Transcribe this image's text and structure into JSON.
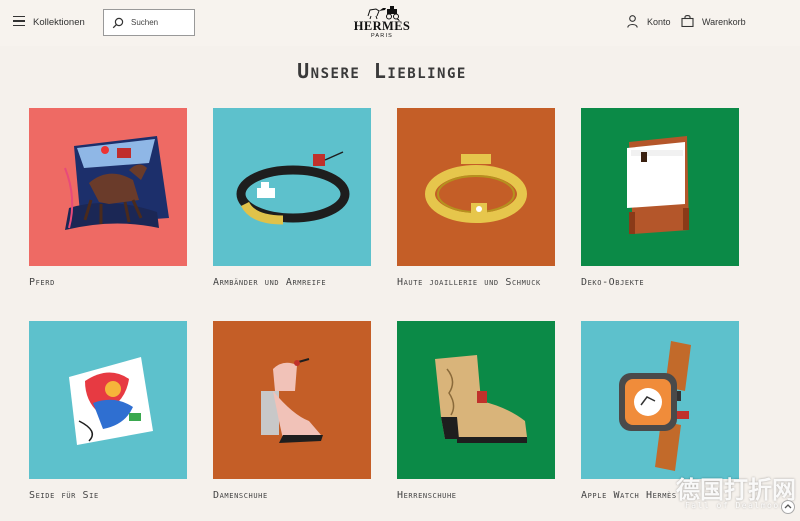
{
  "header": {
    "menu_label": "Kollektionen",
    "search_placeholder": "Suchen",
    "logo_name": "HERMÈS",
    "logo_city": "PARIS",
    "account_label": "Konto",
    "cart_label": "Warenkorb"
  },
  "title": "Unsere Lieblinge",
  "categories": [
    {
      "label": "Pferd",
      "bg": "#ee6a64"
    },
    {
      "label": "Armbänder und Armreife",
      "bg": "#5dc1cc"
    },
    {
      "label": "Haute joaillerie und Schmuck",
      "bg": "#c45e27"
    },
    {
      "label": "Deko-Objekte",
      "bg": "#0b8a47"
    },
    {
      "label": "Seide für Sie",
      "bg": "#5dc1cc"
    },
    {
      "label": "Damenschuhe",
      "bg": "#c45e27"
    },
    {
      "label": "Herrenschuhe",
      "bg": "#0b8a47"
    },
    {
      "label": "Apple Watch Hermès",
      "bg": "#5dc1cc"
    }
  ],
  "watermark": {
    "text": "德国打折网",
    "sub": "Fall of Dealmoon"
  },
  "icons": [
    "menu-icon",
    "search-icon",
    "horse-carriage-logo-icon",
    "account-icon",
    "shopping-bag-icon"
  ]
}
